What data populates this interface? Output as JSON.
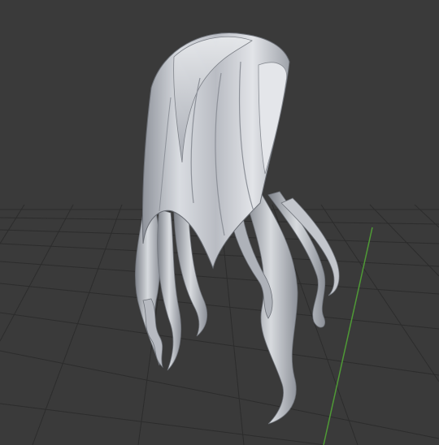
{
  "viewport": {
    "background_color": "#3a3a3a",
    "grid_color": "#2a2a2a",
    "y_axis_color": "#5aa03c",
    "object_name": "hair-mesh",
    "object_color": "#c9ccd2",
    "shading": "solid"
  }
}
